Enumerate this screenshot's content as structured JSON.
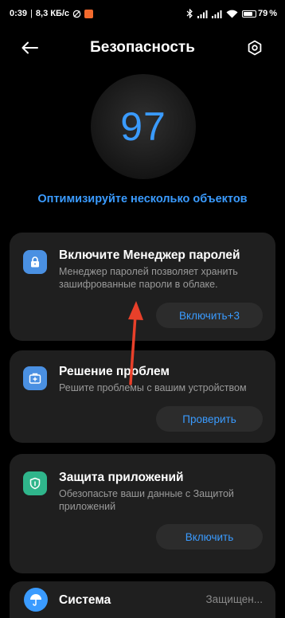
{
  "status_bar": {
    "time": "0:39",
    "speed": "8,3 КБ/с",
    "battery": "79"
  },
  "header": {
    "title": "Безопасность",
    "back_icon": "arrow-left-icon",
    "settings_icon": "gear-icon"
  },
  "score": {
    "value": "97",
    "optimize_label": "Оптимизируйте несколько объектов"
  },
  "cards": [
    {
      "title": "Включите Менеджер паролей",
      "description": "Менеджер паролей позволяет хранить зашифрованные пароли в облаке.",
      "button": "Включить+3",
      "icon": "lock-icon",
      "icon_color": "#4a90e2"
    },
    {
      "title": "Решение проблем",
      "description": "Решите проблемы с вашим устройством",
      "button": "Проверить",
      "icon": "first-aid-icon",
      "icon_color": "#4a90e2"
    },
    {
      "title": "Защита приложений",
      "description": "Обезопасьте ваши данные с Защитой приложений",
      "button": "Включить",
      "icon": "shield-icon",
      "icon_color": "#2fb58b"
    },
    {
      "title": "Система",
      "status": "Защищен...",
      "icon": "umbrella-icon",
      "icon_color": "#3a9bff"
    }
  ],
  "colors": {
    "accent": "#3a9bff",
    "annotation_arrow": "#e8402a"
  }
}
